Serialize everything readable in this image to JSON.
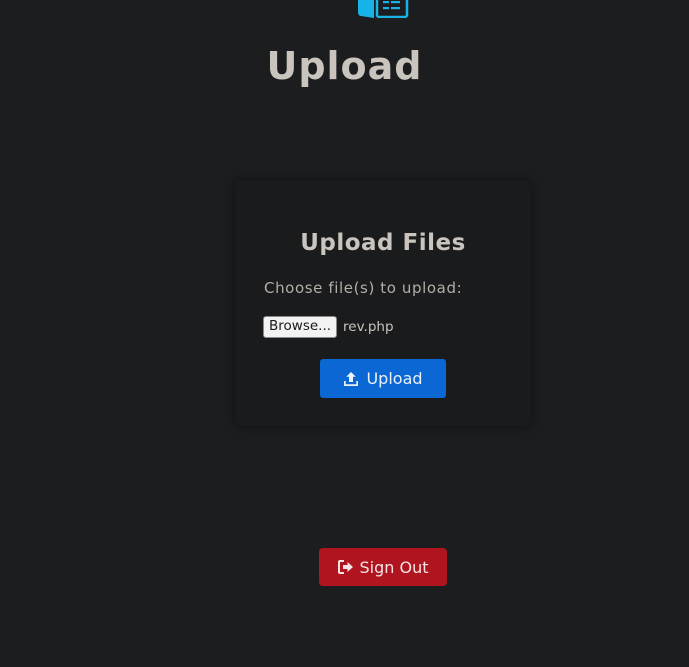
{
  "header": {
    "logo_icon": "book-icon",
    "title": "Upload"
  },
  "upload_card": {
    "title": "Upload Files",
    "choose_label": "Choose file(s) to upload:",
    "browse_label": "Browse...",
    "selected_file": "rev.php",
    "upload_icon": "upload-icon",
    "upload_label": "Upload"
  },
  "signout": {
    "icon": "sign-out-icon",
    "label": "Sign Out"
  },
  "colors": {
    "background": "#1b1d1f",
    "accent_blue": "#0b67d4",
    "logo_cyan": "#17b3e8",
    "danger_red": "#b0151f"
  }
}
